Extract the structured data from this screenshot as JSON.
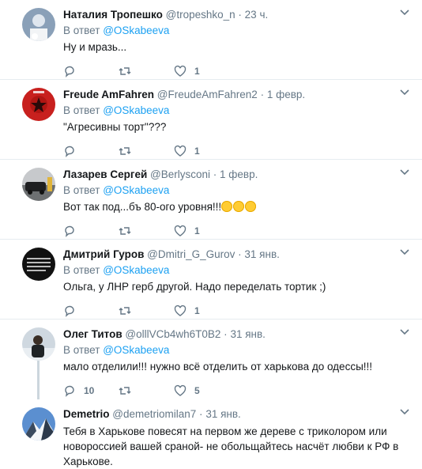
{
  "reply_prefix": "В ответ",
  "tweets": [
    {
      "name": "Наталия Тропешко",
      "handle": "@tropeshko_n",
      "time": "23 ч.",
      "reply_to": "@OSkabeeva",
      "text": "Ну и мразь...",
      "emoji": "",
      "replies": "",
      "retweets": "",
      "likes": "1"
    },
    {
      "name": "Freude AmFahren",
      "handle": "@FreudeAmFahren2",
      "time": "1 февр.",
      "reply_to": "@OSkabeeva",
      "text": "\"Агресивны торт\"???",
      "emoji": "",
      "replies": "",
      "retweets": "",
      "likes": "1"
    },
    {
      "name": "Лазарев Сергей",
      "handle": "@Berlysconi",
      "time": "1 февр.",
      "reply_to": "@OSkabeeva",
      "text": "Вот так под...бъ 80-ого уровня!!!",
      "emoji": "👏👏👏",
      "replies": "",
      "retweets": "",
      "likes": "1"
    },
    {
      "name": "Дмитрий Гуров",
      "handle": "@Dmitri_G_Gurov",
      "time": "31 янв.",
      "reply_to": "@OSkabeeva",
      "text": "Ольга, у ЛНР герб другой. Надо переделать тортик ;)",
      "emoji": "",
      "replies": "",
      "retweets": "",
      "likes": "1"
    },
    {
      "name": "Олег Титов",
      "handle": "@olllVCb4wh6T0B2",
      "time": "31 янв.",
      "reply_to": "@OSkabeeva",
      "text": "мало отделили!!! нужно всё отделить от харькова до одессы!!!",
      "emoji": "",
      "replies": "10",
      "retweets": "",
      "likes": "5"
    },
    {
      "name": "Demetrio",
      "handle": "@demetriomilan7",
      "time": "31 янв.",
      "reply_to": "",
      "text": "Тебя в Харькове повесят на первом же дереве с триколором или новороссией вашей сраной- не обольщайтесь насчёт любви к РФ в Харькове.",
      "emoji": "",
      "replies": "",
      "retweets": "",
      "likes": ""
    }
  ],
  "colors": {
    "accent": "#1da1f2",
    "secondary_text": "#657786",
    "divider": "#e6ecf0"
  },
  "icons": [
    "reply-icon",
    "retweet-icon",
    "like-icon",
    "caret-down-icon"
  ]
}
